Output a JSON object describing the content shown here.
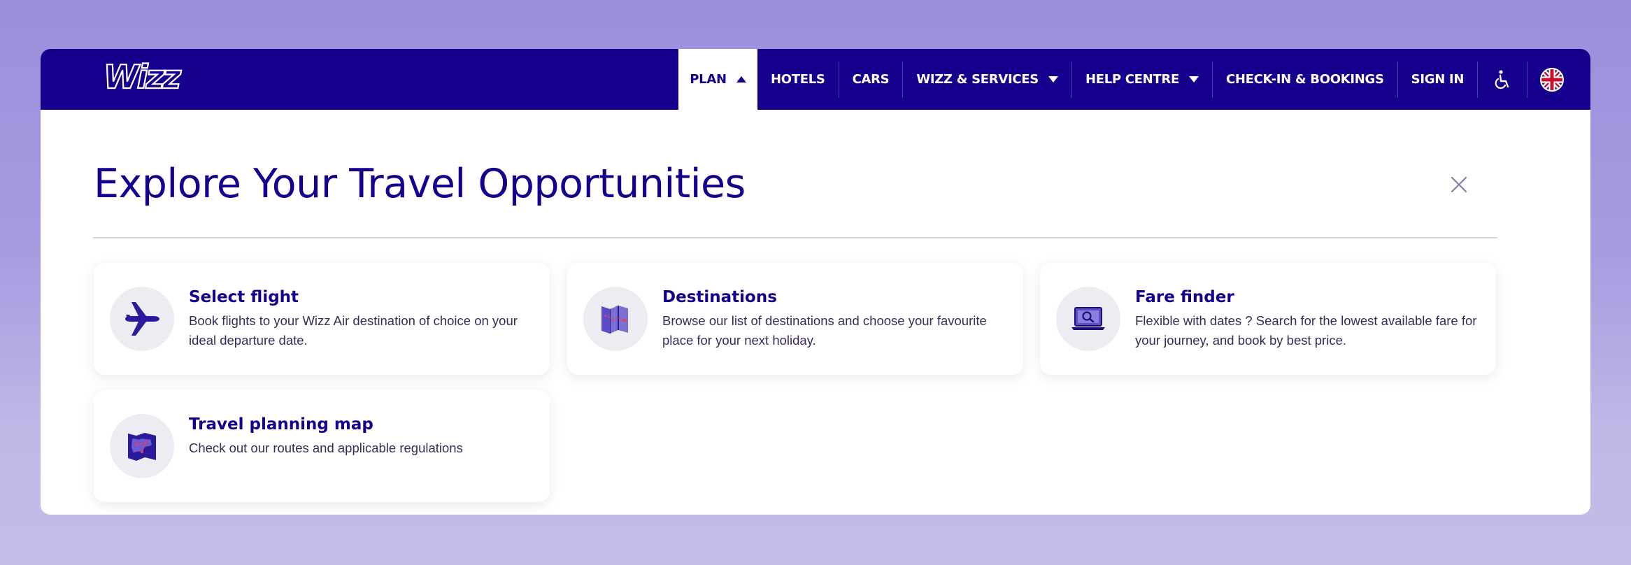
{
  "nav": {
    "logo_text": "Wizz",
    "items": [
      {
        "label": "PLAN"
      },
      {
        "label": "HOTELS"
      },
      {
        "label": "CARS"
      },
      {
        "label": "WIZZ & SERVICES"
      },
      {
        "label": "HELP CENTRE"
      },
      {
        "label": "CHECK-IN & BOOKINGS"
      },
      {
        "label": "SIGN IN"
      }
    ],
    "icons": [
      "accessibility-icon",
      "uk-flag-icon"
    ]
  },
  "panel": {
    "title": "Explore Your Travel Opportunities",
    "cards": [
      {
        "title": "Select flight",
        "desc": "Book flights to your Wizz Air destination of choice on your ideal departure date.",
        "icon": "airplane-icon"
      },
      {
        "title": "Destinations",
        "desc": "Browse our list of destinations and choose your favourite place for your next holiday.",
        "icon": "map-icon"
      },
      {
        "title": "Fare finder",
        "desc": "Flexible with dates ? Search for the lowest available fare for your journey, and book by best price.",
        "icon": "laptop-search-icon"
      },
      {
        "title": "Travel planning map",
        "desc": "Check out our routes and applicable regulations",
        "icon": "europe-map-icon"
      }
    ]
  },
  "colors": {
    "brand": "#14008c",
    "background": "#a79ce0",
    "card_icon_bg": "#ececf2"
  }
}
